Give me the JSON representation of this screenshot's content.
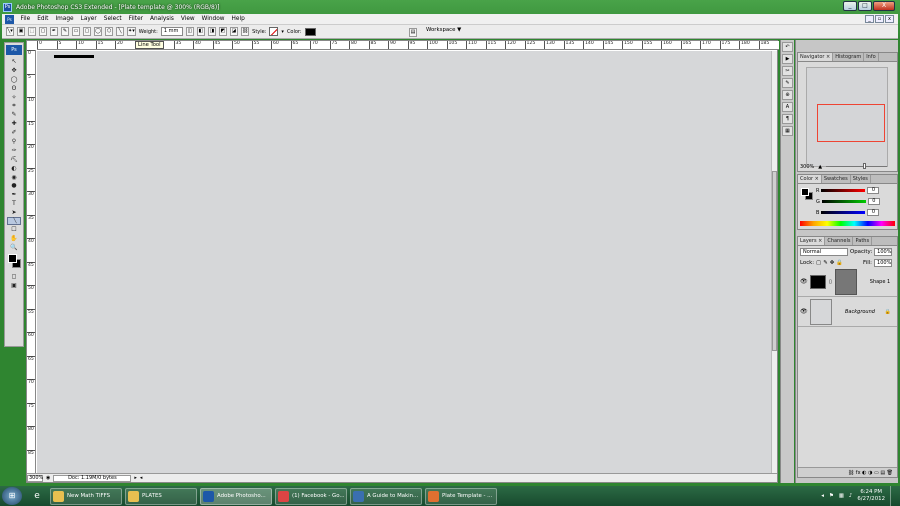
{
  "window": {
    "title": "Adobe Photoshop CS3 Extended - [Plate template @ 300% (RGB/8)]",
    "minimize": "_",
    "maximize": "□",
    "close": "X"
  },
  "menu": [
    "File",
    "Edit",
    "Image",
    "Layer",
    "Select",
    "Filter",
    "Analysis",
    "View",
    "Window",
    "Help"
  ],
  "doc_controls": {
    "minimize": "_",
    "restore": "▫",
    "close": "x"
  },
  "options": {
    "weight_label": "Weight:",
    "weight_value": "1 mm",
    "style_label": "Style:",
    "color_label": "Color:",
    "workspace_label": "Workspace ▼"
  },
  "tooltip": "Line Tool",
  "toolbox": {
    "logo": "Ps",
    "tools": [
      "↖",
      "✥",
      "◯",
      "ʘ",
      "✧",
      "⌗",
      "✎",
      "✚",
      "✐",
      "⚲",
      "✑",
      "⛏",
      "◐",
      "◉",
      "●",
      "✒",
      "T",
      "➤",
      "╲",
      "☐",
      "✋",
      "🔍"
    ]
  },
  "ruler_h": [
    "0",
    "5",
    "10",
    "15",
    "20",
    "25",
    "30",
    "35",
    "40",
    "45",
    "50",
    "55",
    "60",
    "65",
    "70",
    "75",
    "80",
    "85",
    "90",
    "95",
    "100",
    "105",
    "110",
    "115",
    "120",
    "125",
    "130",
    "135",
    "140",
    "145",
    "150",
    "155",
    "160",
    "165",
    "170",
    "175",
    "180",
    "185"
  ],
  "ruler_v": [
    "0",
    "5",
    "10",
    "15",
    "20",
    "25",
    "30",
    "35",
    "40",
    "45",
    "50",
    "55",
    "60",
    "65",
    "70",
    "75",
    "80",
    "85"
  ],
  "status": {
    "zoom": "300%",
    "doc": "Doc: 1.19M/0 bytes"
  },
  "navigator": {
    "tabs": [
      "Navigator ×",
      "Histogram",
      "Info"
    ],
    "zoom": "300%"
  },
  "color": {
    "tabs": [
      "Color ×",
      "Swatches",
      "Styles"
    ],
    "channels": [
      {
        "label": "R",
        "value": "0",
        "grad": "linear-gradient(90deg,#000,#f00)"
      },
      {
        "label": "G",
        "value": "0",
        "grad": "linear-gradient(90deg,#000,#0c0)"
      },
      {
        "label": "B",
        "value": "0",
        "grad": "linear-gradient(90deg,#000,#00f)"
      }
    ]
  },
  "layers": {
    "tabs": [
      "Layers ×",
      "Channels",
      "Paths"
    ],
    "blend": "Normal",
    "opacity_label": "Opacity:",
    "opacity": "100%",
    "lock_label": "Lock:",
    "fill_label": "Fill:",
    "fill": "100%",
    "items": [
      {
        "name": "Shape 1"
      },
      {
        "name": "Background"
      }
    ],
    "footer": "⛓ fx ◐ ◑ ▭ ▤ 🗑"
  },
  "taskbar": {
    "start": "⊞",
    "buttons": [
      {
        "label": "New Math TIFFS",
        "color": "#e8c050"
      },
      {
        "label": "PLATES",
        "color": "#e8c050"
      },
      {
        "label": "Adobe Photosho...",
        "color": "#1d58a8",
        "active": true
      },
      {
        "label": "(1) Facebook - Go...",
        "color": "#d44"
      },
      {
        "label": "A Guide to Makin...",
        "color": "#3a6fb0"
      },
      {
        "label": "Plate Template - ...",
        "color": "#e07030"
      }
    ],
    "time": "6:24 PM",
    "date": "6/27/2012"
  }
}
